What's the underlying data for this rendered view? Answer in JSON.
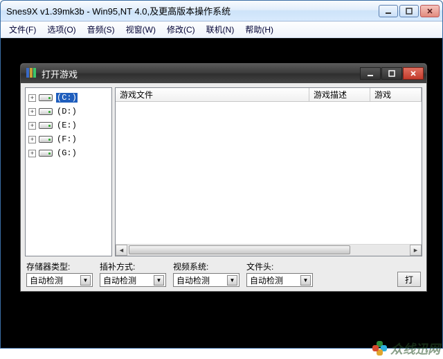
{
  "outerWindow": {
    "title": "Snes9X v1.39mk3b - Win95,NT 4.0,及更高版本操作系统"
  },
  "menu": {
    "items": [
      "文件(F)",
      "选项(O)",
      "音频(S)",
      "视窗(W)",
      "修改(C)",
      "联机(N)",
      "帮助(H)"
    ]
  },
  "dialog": {
    "title": "打开游戏",
    "drives": [
      "(C:)",
      "(D:)",
      "(E:)",
      "(F:)",
      "(G:)"
    ],
    "selectedDriveIndex": 0,
    "columns": {
      "c1": "游戏文件",
      "c2": "游戏描述",
      "c3": "游戏"
    },
    "combos": {
      "storage": {
        "label": "存储器类型:",
        "value": "自动检测"
      },
      "patch": {
        "label": "插补方式:",
        "value": "自动检测"
      },
      "video": {
        "label": "视频系统:",
        "value": "自动检测"
      },
      "header": {
        "label": "文件头:",
        "value": "自动检测"
      }
    },
    "rightButton": "打"
  },
  "watermark": "众线迅网"
}
